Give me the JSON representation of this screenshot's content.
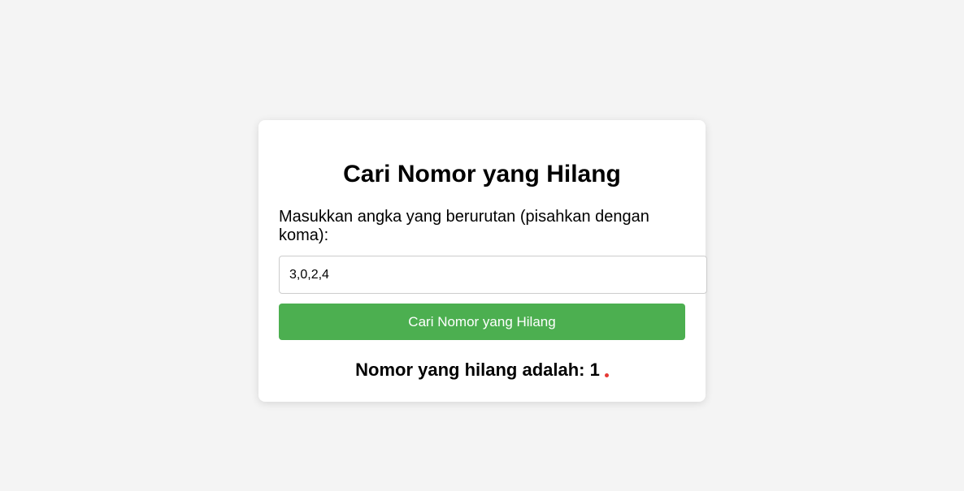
{
  "card": {
    "title": "Cari Nomor yang Hilang",
    "label": "Masukkan angka yang berurutan (pisahkan dengan koma):",
    "input_value": "3,0,2,4",
    "button_label": "Cari Nomor yang Hilang",
    "result_prefix": "Nomor yang hilang adalah: ",
    "result_value": "1"
  },
  "colors": {
    "background": "#f4f4f4",
    "card": "#ffffff",
    "button": "#4caf50",
    "button_text": "#ffffff",
    "indicator_dot": "#e53935"
  }
}
